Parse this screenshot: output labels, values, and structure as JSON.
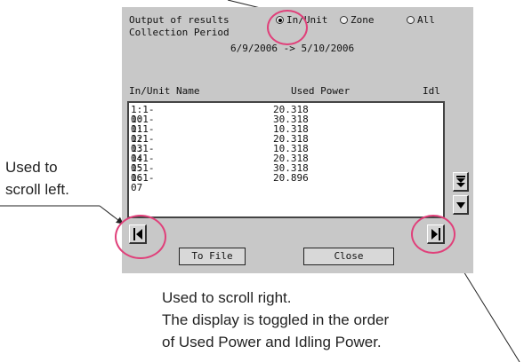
{
  "window": {
    "output_label": "Output of results",
    "period_label": "Collection Period",
    "period_value": "6/9/2006 -> 5/10/2006",
    "radio_options": [
      {
        "label": "In/Unit",
        "selected": true
      },
      {
        "label": "Zone",
        "selected": false
      },
      {
        "label": "All",
        "selected": false
      }
    ]
  },
  "list": {
    "columns": [
      "In/Unit Name",
      "Used Power",
      "Idl"
    ],
    "rows": [
      {
        "name": "1:1-00",
        "value": "20.318"
      },
      {
        "name": "1:1-01",
        "value": "30.318"
      },
      {
        "name": "1:1-02",
        "value": "10.318"
      },
      {
        "name": "1:1-03",
        "value": "20.318"
      },
      {
        "name": "1:1-04",
        "value": "10.318"
      },
      {
        "name": "1:1-05",
        "value": "20.318"
      },
      {
        "name": "1:1-06",
        "value": "30.318"
      },
      {
        "name": "1:1-07",
        "value": "20.896"
      }
    ]
  },
  "buttons": {
    "to_file": "To File",
    "close": "Close",
    "scroll_left_icon": "triangle-left",
    "scroll_right_icon": "triangle-right",
    "scroll_bottom_icon": "double-triangle-down",
    "scroll_down_icon": "triangle-down"
  },
  "annotations": {
    "left_line1": "Used to",
    "left_line2": "scroll left.",
    "right_line1": "Used to scroll right.",
    "right_line2": "The display is toggled in the order",
    "right_line3": "of Used Power and Idling Power."
  },
  "colors": {
    "panel": "#c8c8c8",
    "highlight_circle": "#e0407a"
  }
}
